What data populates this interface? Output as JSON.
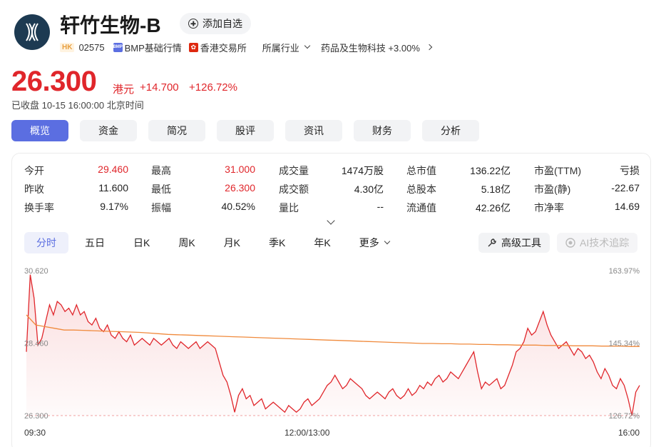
{
  "stock": {
    "name": "轩竹生物-B",
    "market": "HK",
    "code": "02575",
    "bmp": "BMP基础行情",
    "exchange": "香港交易所",
    "industry_label": "所属行业",
    "sector": "药品及生物科技 +3.00%",
    "watch_label": "添加自选"
  },
  "quote": {
    "price": "26.300",
    "unit": "港元",
    "change": "+14.700",
    "change_pct": "+126.72%",
    "status": "已收盘  10-15 16:00:00 北京时间"
  },
  "tabs": [
    "概览",
    "资金",
    "简况",
    "股评",
    "资讯",
    "财务",
    "分析"
  ],
  "stats": [
    [
      {
        "k": "今开",
        "v": "29.460",
        "up": true
      },
      {
        "k": "最高",
        "v": "31.000",
        "up": true
      },
      {
        "k": "成交量",
        "v": "1474万股"
      },
      {
        "k": "总市值",
        "v": "136.22亿"
      },
      {
        "k": "市盈(TTM)",
        "v": "亏损"
      }
    ],
    [
      {
        "k": "昨收",
        "v": "11.600"
      },
      {
        "k": "最低",
        "v": "26.300",
        "up": true
      },
      {
        "k": "成交额",
        "v": "4.30亿"
      },
      {
        "k": "总股本",
        "v": "5.18亿"
      },
      {
        "k": "市盈(静)",
        "v": "-22.67"
      }
    ],
    [
      {
        "k": "换手率",
        "v": "9.17%"
      },
      {
        "k": "振幅",
        "v": "40.52%"
      },
      {
        "k": "量比",
        "v": "--"
      },
      {
        "k": "流通值",
        "v": "42.26亿"
      },
      {
        "k": "市净率",
        "v": "14.69"
      }
    ]
  ],
  "chart_tabs": [
    "分时",
    "五日",
    "日K",
    "周K",
    "月K",
    "季K",
    "年K",
    "更多"
  ],
  "adv_tool": "高级工具",
  "ai_tool": "AI技术追踪",
  "chart_data": {
    "type": "line",
    "y_left": [
      "30.620",
      "28.460",
      "26.300"
    ],
    "y_right": [
      "163.97%",
      "145.34%",
      "126.72%"
    ],
    "x_labels": [
      "09:30",
      "12:00/13:00",
      "16:00"
    ],
    "ylim": [
      26.3,
      30.62
    ],
    "series": [
      {
        "color": "#e0262b",
        "values": [
          28.2,
          30.5,
          29.8,
          28.4,
          28.6,
          29.1,
          29.6,
          29.3,
          29.7,
          29.6,
          29.4,
          29.5,
          29.3,
          29.6,
          29.3,
          29.4,
          29.1,
          29.0,
          29.2,
          28.9,
          28.8,
          29.0,
          28.7,
          28.6,
          28.8,
          28.6,
          28.5,
          28.7,
          28.4,
          28.5,
          28.6,
          28.5,
          28.4,
          28.6,
          28.5,
          28.4,
          28.5,
          28.6,
          28.4,
          28.3,
          28.5,
          28.4,
          28.3,
          28.4,
          28.5,
          28.3,
          28.4,
          28.5,
          28.4,
          28.3,
          27.9,
          27.5,
          27.3,
          26.9,
          26.4,
          26.9,
          27.1,
          26.8,
          26.9,
          26.6,
          26.7,
          26.8,
          26.5,
          26.6,
          26.7,
          26.6,
          26.5,
          26.4,
          26.6,
          26.5,
          26.4,
          26.5,
          26.7,
          26.8,
          26.6,
          26.7,
          26.8,
          27.0,
          27.2,
          27.3,
          27.5,
          27.3,
          27.1,
          27.2,
          27.4,
          27.3,
          27.2,
          27.1,
          26.9,
          26.8,
          26.9,
          27.0,
          26.9,
          26.8,
          27.0,
          27.1,
          26.9,
          26.8,
          26.9,
          27.1,
          26.9,
          27.0,
          27.2,
          27.1,
          27.3,
          27.2,
          27.4,
          27.5,
          27.3,
          27.4,
          27.6,
          27.5,
          27.4,
          27.6,
          27.8,
          28.0,
          28.2,
          27.6,
          27.1,
          27.3,
          27.2,
          27.3,
          27.4,
          27.1,
          27.2,
          27.5,
          27.8,
          28.2,
          28.3,
          28.5,
          28.9,
          28.7,
          28.8,
          29.1,
          29.4,
          29.0,
          28.7,
          28.5,
          28.3,
          28.4,
          28.5,
          28.3,
          28.1,
          28.3,
          28.2,
          28.0,
          28.1,
          27.9,
          27.6,
          27.4,
          27.7,
          27.5,
          27.2,
          27.1,
          27.4,
          27.2,
          26.8,
          26.3,
          27.0,
          27.2
        ]
      },
      {
        "color": "#f08a3c",
        "values": [
          29.3,
          29.0,
          28.95,
          28.9,
          28.85,
          28.85,
          28.84,
          28.83,
          28.82,
          28.81,
          28.8,
          28.79,
          28.78,
          28.76,
          28.74,
          28.72,
          28.71,
          28.7,
          28.69,
          28.68,
          28.67,
          28.66,
          28.65,
          28.64,
          28.63,
          28.62,
          28.61,
          28.6,
          28.59,
          28.58,
          28.57,
          28.56,
          28.55,
          28.54,
          28.53,
          28.52,
          28.51,
          28.5,
          28.49,
          28.48,
          28.47,
          28.46,
          28.45,
          28.45,
          28.44,
          28.44,
          28.43,
          28.43,
          28.42,
          28.42,
          28.41,
          28.41,
          28.4,
          28.4,
          28.4,
          28.39,
          28.39,
          28.39,
          28.38,
          28.38,
          28.38,
          28.37,
          28.37,
          28.37,
          28.36,
          28.36
        ]
      }
    ]
  }
}
